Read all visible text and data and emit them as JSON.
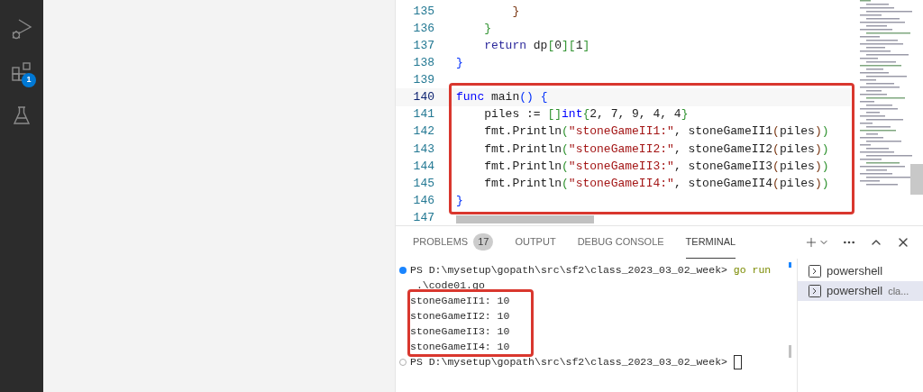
{
  "activity_bar": {
    "items": [
      {
        "kind": "run-debug"
      },
      {
        "kind": "extensions",
        "badge": "1"
      },
      {
        "kind": "testing"
      }
    ]
  },
  "editor": {
    "segments": [
      {
        "boxed": false,
        "lines": [
          {
            "number": "135",
            "current": false,
            "tokens": [
              {
                "text": "        }",
                "kind": "bracket3"
              }
            ]
          },
          {
            "number": "136",
            "current": false,
            "tokens": [
              {
                "text": "    }",
                "kind": "bracket2"
              }
            ]
          },
          {
            "number": "137",
            "current": false,
            "tokens": [
              {
                "text": "    return",
                "kind": "control"
              },
              {
                "text": " dp",
                "kind": "plain"
              },
              {
                "text": "[",
                "kind": "bracket2"
              },
              {
                "text": "0",
                "kind": "number"
              },
              {
                "text": "][",
                "kind": "bracket2"
              },
              {
                "text": "1",
                "kind": "number"
              },
              {
                "text": "]",
                "kind": "bracket2"
              }
            ]
          },
          {
            "number": "138",
            "current": false,
            "tokens": [
              {
                "text": "}",
                "kind": "bracket1"
              }
            ]
          },
          {
            "number": "139",
            "current": false
          }
        ]
      },
      {
        "boxed": true,
        "lines": [
          {
            "number": "140",
            "current": true,
            "tokens": [
              {
                "text": "func",
                "kind": "keyword"
              },
              {
                "text": " main",
                "kind": "func"
              },
              {
                "text": "()",
                "kind": "bracket1"
              },
              {
                "text": " {",
                "kind": "bracket1"
              }
            ]
          },
          {
            "number": "141",
            "current": false,
            "tokens": [
              {
                "text": "    piles := ",
                "kind": "plain"
              },
              {
                "text": "[]",
                "kind": "bracket2"
              },
              {
                "text": "int",
                "kind": "type"
              },
              {
                "text": "{",
                "kind": "bracket2"
              },
              {
                "text": "2, 7, 9, 4, 4",
                "kind": "number"
              },
              {
                "text": "}",
                "kind": "bracket2"
              }
            ]
          },
          {
            "number": "142",
            "current": false,
            "tokens": [
              {
                "text": "    fmt.Println",
                "kind": "plain"
              },
              {
                "text": "(",
                "kind": "bracket2"
              },
              {
                "text": "\"stoneGameII1:\"",
                "kind": "string"
              },
              {
                "text": ", stoneGameII1",
                "kind": "plain"
              },
              {
                "text": "(",
                "kind": "bracket3"
              },
              {
                "text": "piles",
                "kind": "plain"
              },
              {
                "text": ")",
                "kind": "bracket3"
              },
              {
                "text": ")",
                "kind": "bracket2"
              }
            ]
          },
          {
            "number": "143",
            "current": false,
            "tokens": [
              {
                "text": "    fmt.Println",
                "kind": "plain"
              },
              {
                "text": "(",
                "kind": "bracket2"
              },
              {
                "text": "\"stoneGameII2:\"",
                "kind": "string"
              },
              {
                "text": ", stoneGameII2",
                "kind": "plain"
              },
              {
                "text": "(",
                "kind": "bracket3"
              },
              {
                "text": "piles",
                "kind": "plain"
              },
              {
                "text": ")",
                "kind": "bracket3"
              },
              {
                "text": ")",
                "kind": "bracket2"
              }
            ]
          },
          {
            "number": "144",
            "current": false,
            "tokens": [
              {
                "text": "    fmt.Println",
                "kind": "plain"
              },
              {
                "text": "(",
                "kind": "bracket2"
              },
              {
                "text": "\"stoneGameII3:\"",
                "kind": "string"
              },
              {
                "text": ", stoneGameII3",
                "kind": "plain"
              },
              {
                "text": "(",
                "kind": "bracket3"
              },
              {
                "text": "piles",
                "kind": "plain"
              },
              {
                "text": ")",
                "kind": "bracket3"
              },
              {
                "text": ")",
                "kind": "bracket2"
              }
            ]
          },
          {
            "number": "145",
            "current": false,
            "tokens": [
              {
                "text": "    fmt.Println",
                "kind": "plain"
              },
              {
                "text": "(",
                "kind": "bracket2"
              },
              {
                "text": "\"stoneGameII4:\"",
                "kind": "string"
              },
              {
                "text": ", stoneGameII4",
                "kind": "plain"
              },
              {
                "text": "(",
                "kind": "bracket3"
              },
              {
                "text": "piles",
                "kind": "plain"
              },
              {
                "text": ")",
                "kind": "bracket3"
              },
              {
                "text": ")",
                "kind": "bracket2"
              }
            ]
          },
          {
            "number": "146",
            "current": false,
            "tokens": [
              {
                "text": "}",
                "kind": "bracket1"
              }
            ]
          }
        ]
      },
      {
        "boxed": false,
        "lines": [
          {
            "number": "147",
            "current": false
          }
        ]
      }
    ]
  },
  "panel": {
    "tabs": [
      {
        "label": "PROBLEMS",
        "badge": "17",
        "selected": false
      },
      {
        "label": "OUTPUT",
        "selected": false
      },
      {
        "label": "DEBUG CONSOLE",
        "selected": false
      },
      {
        "label": "TERMINAL",
        "selected": true
      }
    ],
    "terminal": {
      "segments": [
        {
          "boxed": false,
          "lines": [
            {
              "succeeded": true,
              "prompt": "PS D:\\mysetup\\gopath\\src\\sf2\\class_2023_03_02_week> ",
              "command": "go run"
            },
            {
              "text": " .\\code01.go"
            }
          ]
        },
        {
          "boxed": true,
          "lines": [
            {
              "text": "stoneGameII1: 10"
            },
            {
              "text": "stoneGameII2: 10"
            },
            {
              "text": "stoneGameII3: 10"
            },
            {
              "text": "stoneGameII4: 10"
            }
          ]
        },
        {
          "boxed": false,
          "lines": [
            {
              "succeeded": false,
              "prompt": "PS D:\\mysetup\\gopath\\src\\sf2\\class_2023_03_02_week> ",
              "cursor": true
            }
          ]
        }
      ]
    },
    "terminals": [
      {
        "name": "powershell",
        "selected": false
      },
      {
        "name": "powershell",
        "detail": "cla...",
        "selected": true
      }
    ]
  }
}
